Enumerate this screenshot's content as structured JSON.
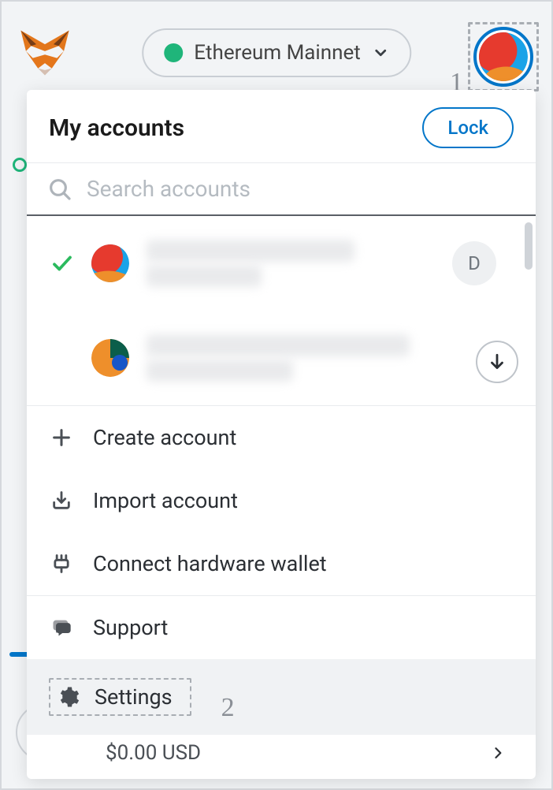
{
  "header": {
    "network_name": "Ethereum Mainnet",
    "network_dot_color": "#1fb57a"
  },
  "panel": {
    "title": "My accounts",
    "lock_label": "Lock",
    "search_placeholder": "Search accounts"
  },
  "accounts": [
    {
      "selected": true,
      "badge": "D"
    },
    {
      "selected": false,
      "badge": ""
    }
  ],
  "menu": {
    "create": "Create account",
    "import": "Import account",
    "hardware": "Connect hardware wallet",
    "support": "Support",
    "settings": "Settings"
  },
  "annotations": {
    "step1": "1",
    "step2": "2"
  },
  "background": {
    "balance": "$0.00 USD"
  }
}
